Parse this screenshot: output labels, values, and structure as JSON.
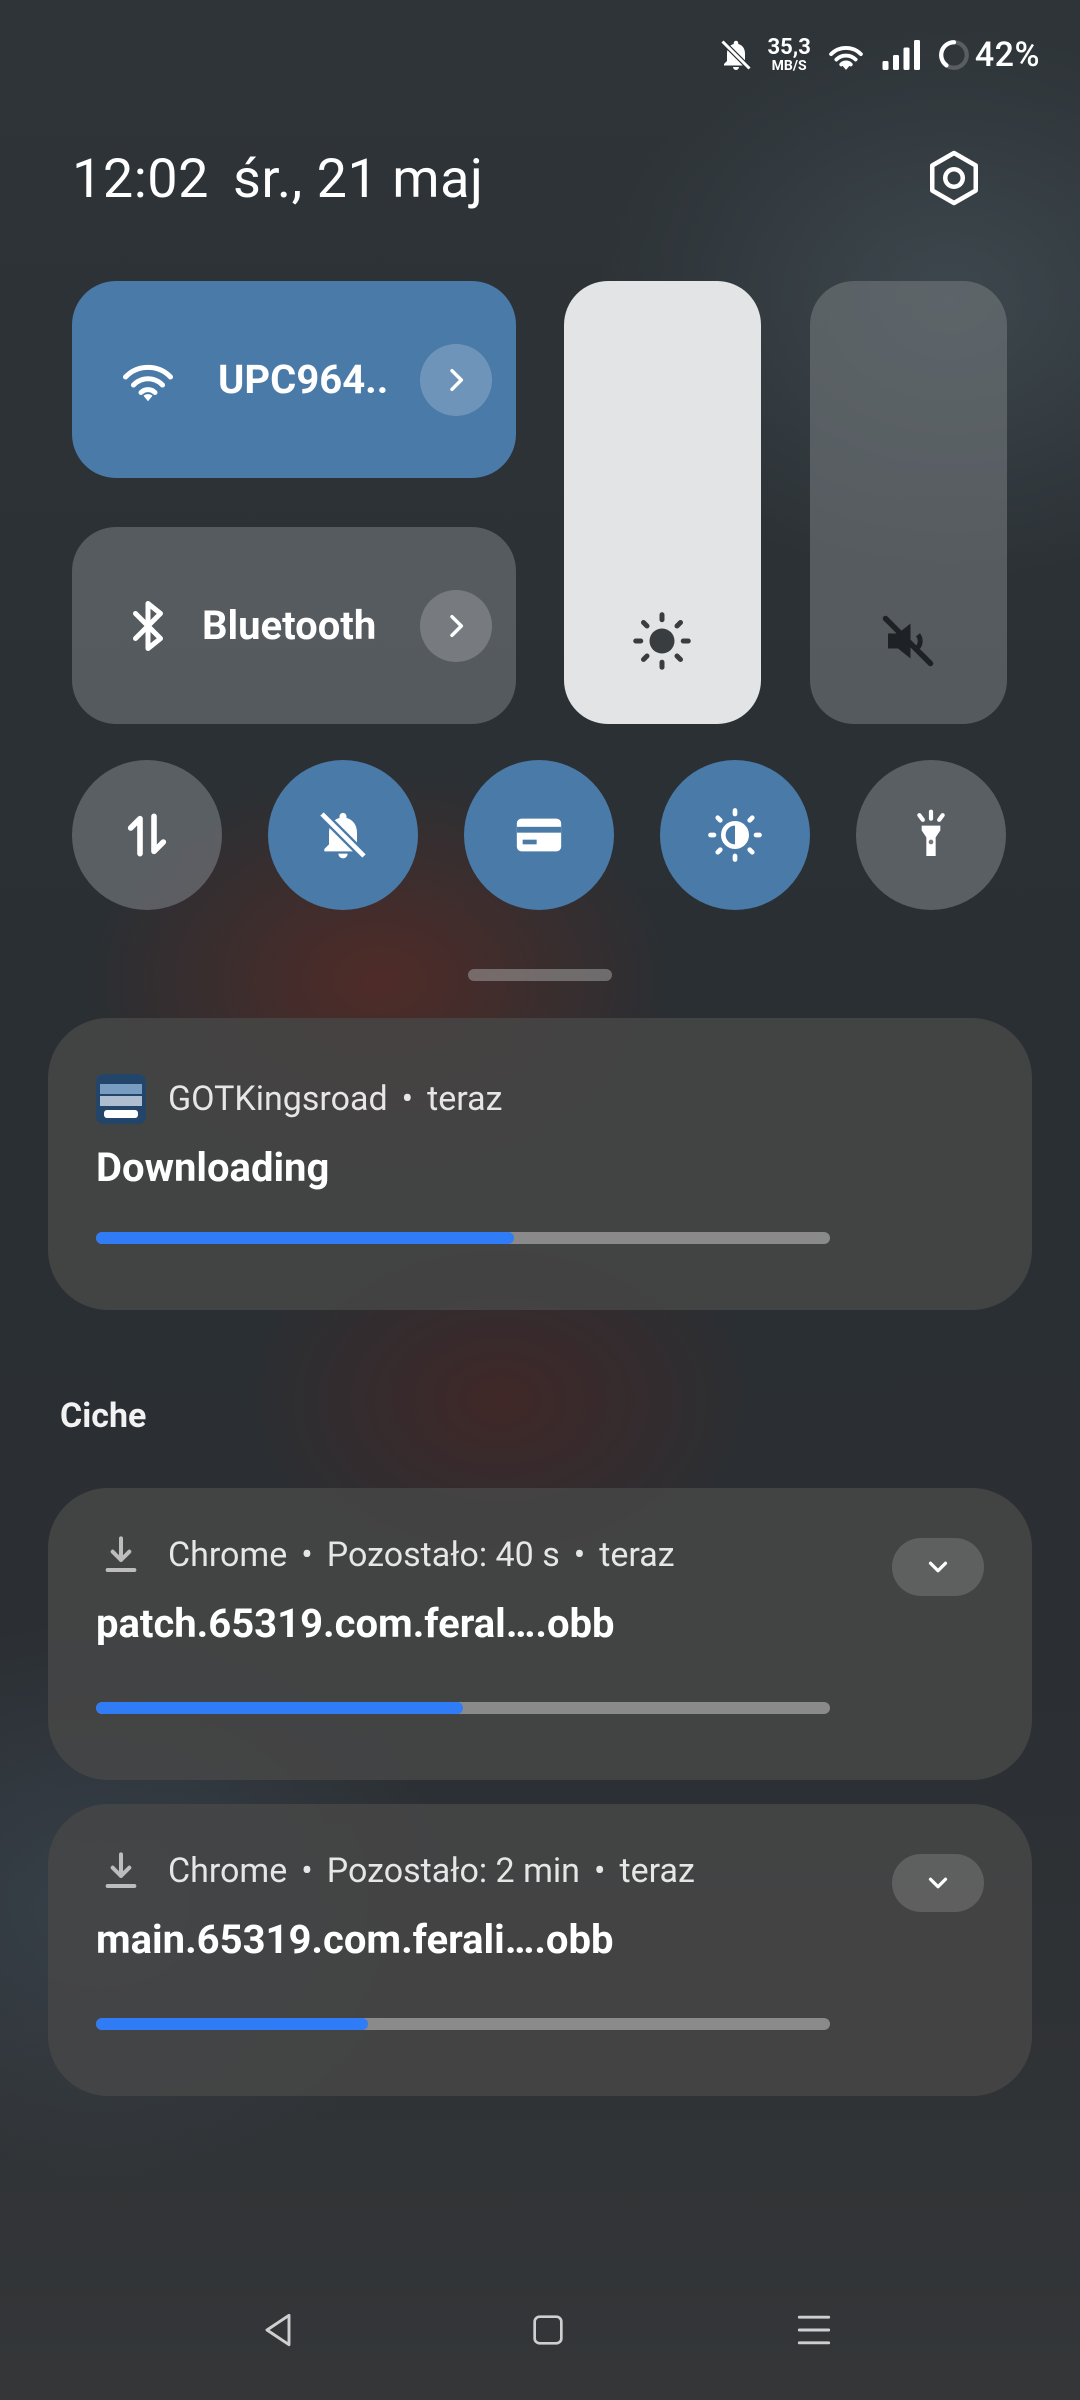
{
  "status_bar": {
    "speed_value": "35,3",
    "speed_unit": "MB/S",
    "battery_percent": "42%",
    "icons": [
      "bell-off-icon",
      "wifi-icon",
      "signal-icon",
      "battery-ring-icon"
    ]
  },
  "header": {
    "time": "12:02",
    "date": "śr., 21 maj",
    "settings_icon": "gear-icon"
  },
  "quick_settings": {
    "wifi": {
      "label": "UPC964..",
      "icon": "wifi-icon",
      "active": true
    },
    "bluetooth": {
      "label": "Bluetooth",
      "icon": "bluetooth-icon",
      "active": false
    },
    "brightness_slider": {
      "icon": "brightness-icon"
    },
    "volume_slider": {
      "icon": "volume-mute-icon"
    },
    "toggles": [
      {
        "name": "mobile-data",
        "icon": "data-arrows-icon",
        "active": false
      },
      {
        "name": "silent",
        "icon": "bell-off-icon",
        "active": true
      },
      {
        "name": "wallet",
        "icon": "card-icon",
        "active": true
      },
      {
        "name": "eye-comfort",
        "icon": "contrast-icon",
        "active": true
      },
      {
        "name": "flashlight",
        "icon": "flashlight-icon",
        "active": false
      }
    ]
  },
  "notifications": {
    "ongoing": {
      "app": "GOTKingsroad",
      "time": "teraz",
      "title": "Downloading",
      "progress": 0.57
    },
    "section_title": "Ciche",
    "silent": [
      {
        "app": "Chrome",
        "remaining": "Pozostało: 40 s",
        "time": "teraz",
        "title": "patch.65319.com.feral….obb",
        "progress": 0.5
      },
      {
        "app": "Chrome",
        "remaining": "Pozostało: 2 min",
        "time": "teraz",
        "title": "main.65319.com.ferali….obb",
        "progress": 0.37
      }
    ]
  },
  "nav_bar": {
    "icons": [
      "back-icon",
      "home-icon",
      "recents-icon"
    ]
  },
  "colors": {
    "accent": "#4a7aa8",
    "progress": "#2f7cf6"
  }
}
